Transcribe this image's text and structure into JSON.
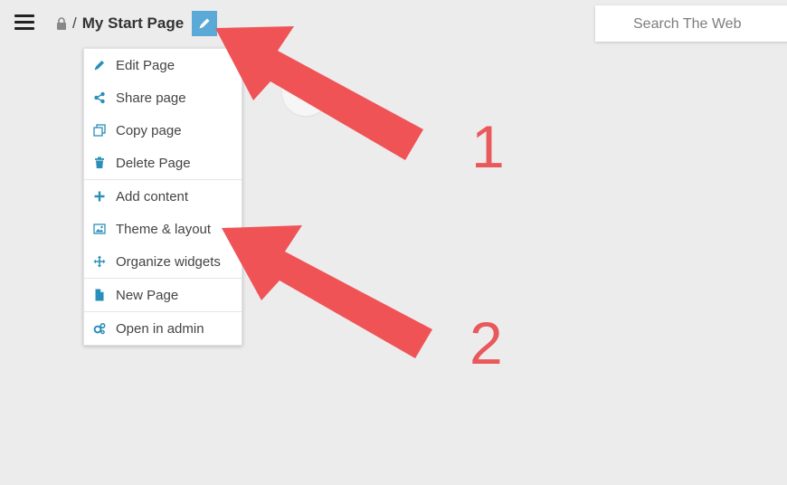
{
  "header": {
    "breadcrumb_separator": "/",
    "page_title": "My Start Page"
  },
  "search": {
    "placeholder": "Search The Web"
  },
  "menu": {
    "groups": [
      [
        {
          "label": "Edit Page",
          "icon": "pencil-icon"
        },
        {
          "label": "Share page",
          "icon": "share-icon"
        },
        {
          "label": "Copy page",
          "icon": "copy-icon"
        },
        {
          "label": "Delete Page",
          "icon": "trash-icon"
        }
      ],
      [
        {
          "label": "Add content",
          "icon": "plus-icon"
        },
        {
          "label": "Theme & layout",
          "icon": "image-icon"
        },
        {
          "label": "Organize widgets",
          "icon": "move-icon"
        }
      ],
      [
        {
          "label": "New Page",
          "icon": "file-icon"
        }
      ],
      [
        {
          "label": "Open in admin",
          "icon": "gears-icon"
        }
      ]
    ]
  },
  "annotations": {
    "label_1": "1",
    "label_2": "2",
    "arrow_color": "#f05356"
  },
  "colors": {
    "accent": "#5aa9d6",
    "menu_icon": "#2a8fb8",
    "background": "#edeced"
  }
}
